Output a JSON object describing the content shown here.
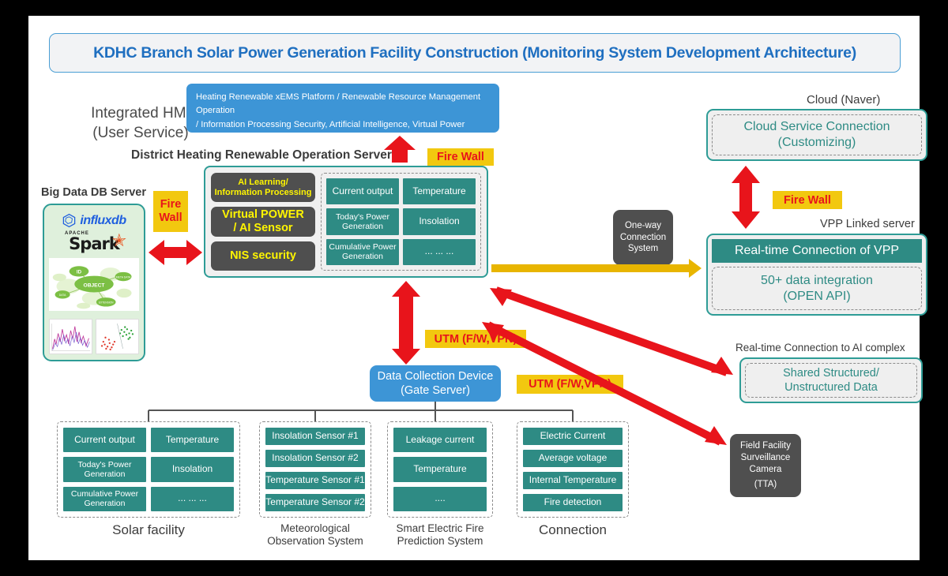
{
  "title": "KDHC Branch Solar Power Generation Facility Construction (Monitoring System Development Architecture)",
  "hmi": {
    "label_line1": "Integrated HMI",
    "label_line2": "(User Service)",
    "box_line1": "Heating Renewable xEMS Platform / Renewable Resource Management Operation",
    "box_line2": "/ Information Processing Security, Artificial Intelligence, Virtual Power Plant, Big Data"
  },
  "server": {
    "title": "District Heating Renewable Operation Server",
    "gray_cards": [
      "AI Learning/ Information Processing",
      "Virtual POWER / AI Sensor",
      "NIS security"
    ],
    "gray_card_lines": {
      "card0_l1": "AI Learning/",
      "card0_l2": "Information Processing",
      "card1_l1": "Virtual POWER",
      "card1_l2": "/ AI Sensor",
      "card2_l1": "NIS security"
    },
    "metric_cards": [
      "Current output",
      "Temperature",
      "Today's Power Generation",
      "Insolation",
      "Cumulative Power Generation",
      "... ... ..."
    ]
  },
  "bigdata": {
    "title": "Big Data DB Server",
    "influxdb": "influxdb",
    "spark_apache": "APACHE",
    "spark_word": "Spark",
    "graph_nodes": [
      "ID",
      "OBJECT",
      "DATA",
      "META DATA",
      "EXTENSION"
    ]
  },
  "firewalls": {
    "left_line1": "Fire",
    "left_line2": "Wall",
    "top": "Fire Wall",
    "cloud": "Fire Wall"
  },
  "utm": {
    "center": "UTM (F/W,VPN)",
    "right": "UTM (F/W,VPN)"
  },
  "oneway": {
    "line1": "One-way",
    "line2": "Connection",
    "line3": "System"
  },
  "cloud": {
    "label": "Cloud (Naver)",
    "box_line1": "Cloud Service Connection",
    "box_line2": "(Customizing)"
  },
  "vpp": {
    "label": "VPP Linked server",
    "header": "Real-time Connection of VPP",
    "body_line1": "50+ data integration",
    "body_line2": "(OPEN API)"
  },
  "ai_complex": {
    "label": "Real-time Connection to AI complex",
    "box_line1": "Shared Structured/",
    "box_line2": "Unstructured Data"
  },
  "camera": {
    "line1": "Field Facility",
    "line2": "Surveillance",
    "line3": "Camera",
    "line4": "(TTA)"
  },
  "dcd": {
    "line1": "Data Collection Device",
    "line2": "(Gate Server)"
  },
  "groups": [
    {
      "caption_line1": "Solar facility",
      "caption_line2": "",
      "items": [
        "Current output",
        "Temperature",
        "Today's Power Generation",
        "Insolation",
        "Cumulative Power Generation",
        "... ... ..."
      ]
    },
    {
      "caption_line1": "Meteorological",
      "caption_line2": "Observation System",
      "items": [
        "Insolation Sensor #1",
        "Insolation Sensor #2",
        "Temperature Sensor #1",
        "Temperature Sensor #2"
      ]
    },
    {
      "caption_line1": "Smart Electric Fire",
      "caption_line2": "Prediction System",
      "items": [
        "Leakage current",
        "Temperature",
        "...."
      ]
    },
    {
      "caption_line1": "Connection",
      "caption_line2": "",
      "items": [
        "Electric Current",
        "Average voltage",
        "Internal Temperature",
        "Fire detection"
      ]
    }
  ],
  "colors": {
    "title_text": "#1f6fc0",
    "teal": "#2e8b84",
    "teal_border": "#2e9c96",
    "blue": "#3d95d6",
    "gray_card": "#4f4f4f",
    "yellow_tag": "#f2c80f",
    "tag_text": "#e8141b",
    "arrow_red": "#e8141b",
    "arrow_gold": "#e8b500",
    "gray_text": "#4a4a4a"
  }
}
